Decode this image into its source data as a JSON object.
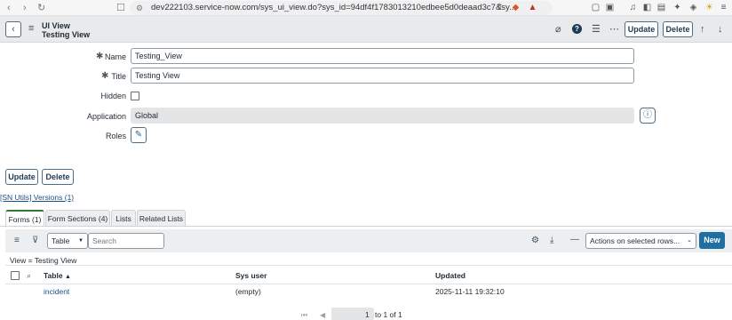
{
  "browser": {
    "url": "dev222103.service-now.com/sys_ui_view.do?sys_id=94df4f1783013210edbee5d0deaad3c7&sy..."
  },
  "header": {
    "record_type": "UI View",
    "record_name": "Testing View",
    "update_label": "Update",
    "delete_label": "Delete"
  },
  "form": {
    "name_label": "Name",
    "name_value": "Testing_View",
    "title_label": "Title",
    "title_value": "Testing View",
    "hidden_label": "Hidden",
    "application_label": "Application",
    "application_value": "Global",
    "roles_label": "Roles",
    "update_label": "Update",
    "delete_label": "Delete"
  },
  "related_link": "[SN Utils] Versions (1)",
  "tabs": [
    {
      "label": "Forms (1)",
      "active": true
    },
    {
      "label": "Form Sections (4)",
      "active": false
    },
    {
      "label": "Lists",
      "active": false
    },
    {
      "label": "Related Lists",
      "active": false
    }
  ],
  "list": {
    "search_field": "Table",
    "search_placeholder": "Search",
    "actions_select": "Actions on selected rows...",
    "new_label": "New",
    "breadcrumb": "View = Testing View",
    "columns": [
      "Table",
      "Sys user",
      "Updated"
    ],
    "rows": [
      {
        "table": "incident",
        "sys_user": "(empty)",
        "updated": "2025-11-11 19:32:10"
      }
    ],
    "pager": {
      "current": "1",
      "text": "to 1 of 1"
    }
  },
  "colors": {
    "accent": "#1f6fa3",
    "active_tab": "#2e7d32",
    "link": "#1a4f8c"
  }
}
